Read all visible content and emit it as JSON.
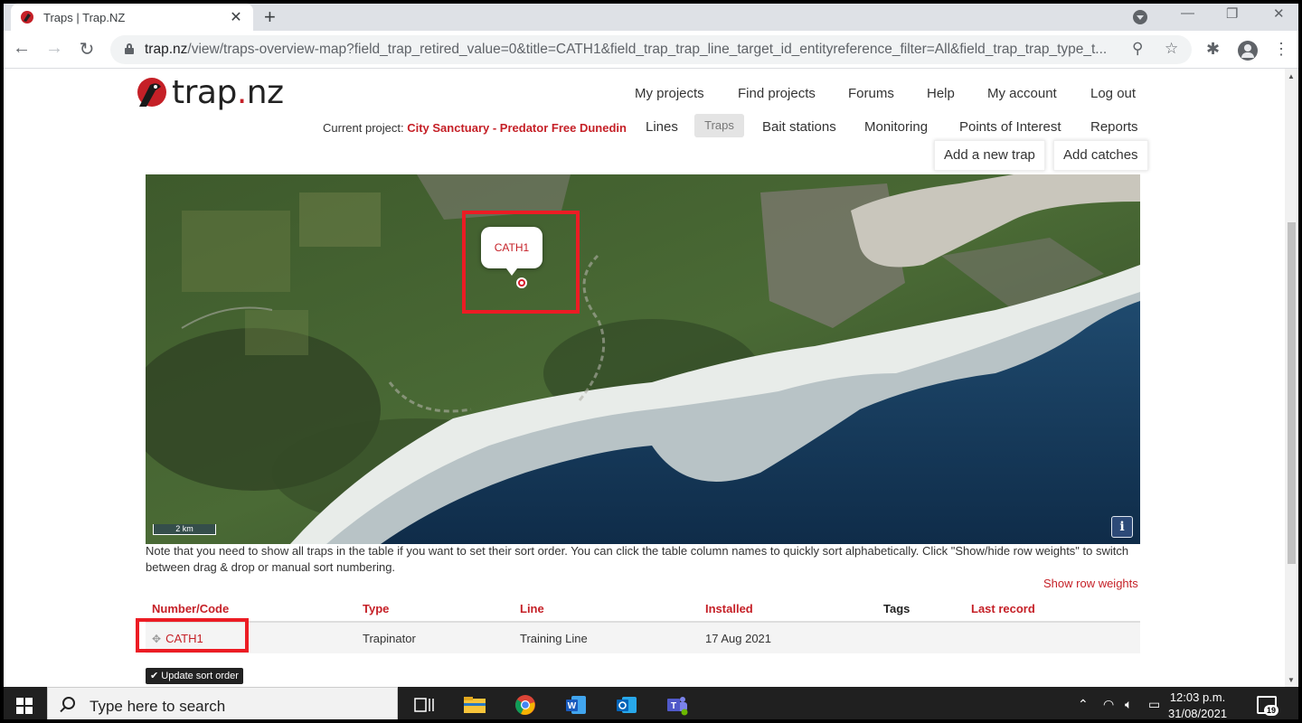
{
  "browser": {
    "tab_title": "Traps | Trap.NZ",
    "url_host": "trap.nz",
    "url_path": "/view/traps-overview-map?field_trap_retired_value=0&title=CATH1&field_trap_trap_line_target_id_entityreference_filter=All&field_trap_trap_type_t..."
  },
  "site": {
    "logo_name": "trap",
    "logo_dot": ".",
    "logo_tld": "nz",
    "top_nav": [
      "My projects",
      "Find projects",
      "Forums",
      "Help",
      "My account",
      "Log out"
    ],
    "current_project_label": "Current project:",
    "current_project_name": "City Sanctuary - Predator Free Dunedin",
    "sub_nav": [
      "Lines",
      "Traps",
      "Bait stations",
      "Monitoring",
      "Points of Interest",
      "Reports"
    ],
    "active_sub_nav": "Traps",
    "actions": [
      "Add a new trap",
      "Add catches"
    ]
  },
  "map": {
    "popup_label": "CATH1",
    "scale_label": "2 km",
    "info_label": "i"
  },
  "note": "Note that you need to show all traps in the table if you want to set their sort order. You can click the table column names to quickly sort alphabetically. Click \"Show/hide row weights\" to switch between drag & drop or manual sort numbering.",
  "show_row_weights": "Show row weights",
  "table": {
    "columns": [
      "Number/Code",
      "Type",
      "Line",
      "Installed",
      "Tags",
      "Last record"
    ],
    "rows": [
      {
        "code": "CATH1",
        "type": "Trapinator",
        "line": "Training Line",
        "installed": "17 Aug 2021",
        "tags": "",
        "last_record": ""
      }
    ]
  },
  "update_sort_order": "Update sort order",
  "taskbar": {
    "search_placeholder": "Type here to search",
    "time": "12:03 p.m.",
    "date": "31/08/2021",
    "notification_count": "19"
  },
  "colors": {
    "brand_red": "#c52027",
    "highlight_red": "#ec1c24"
  }
}
